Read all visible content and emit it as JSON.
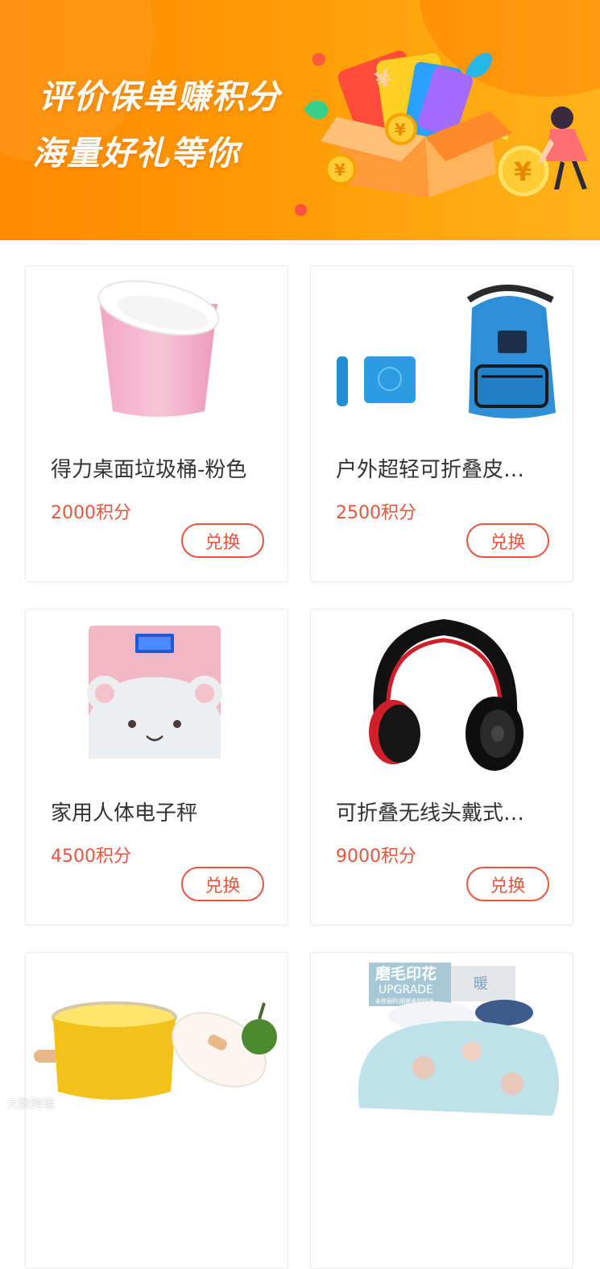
{
  "banner": {
    "title": "评价保单赚积分",
    "subtitle": "海量好礼等你",
    "currency_symbol": "¥"
  },
  "products": [
    {
      "name": "得力桌面垃圾桶-粉色",
      "points": "2000积分",
      "button": "兑换",
      "image_icon": "pink-trash-bin-image"
    },
    {
      "name": "户外超轻可折叠皮肤包",
      "display_name": "户外超轻可折叠皮…",
      "points": "2500积分",
      "button": "兑换",
      "image_icon": "blue-backpack-image"
    },
    {
      "name": "家用人体电子秤",
      "points": "4500积分",
      "button": "兑换",
      "image_icon": "bathroom-scale-image"
    },
    {
      "name": "可折叠无线头戴式耳机",
      "display_name": "可折叠无线头戴式…",
      "points": "9000积分",
      "button": "兑换",
      "image_icon": "headphones-image"
    },
    {
      "name": "",
      "points": "",
      "button": "",
      "image_icon": "yellow-pot-image"
    },
    {
      "name": "",
      "points": "",
      "button": "",
      "image_icon": "quilt-image",
      "image_text": {
        "headline": "磨毛印花",
        "upgrade": "UPGRADE",
        "small": "亲肤面料|细腻柔软舒适",
        "side": "暖"
      }
    }
  ],
  "watermark": "大数跨境",
  "colors": {
    "accent": "#e8553e",
    "banner_start": "#ff8a00",
    "banner_end": "#ffb31a",
    "text": "#333333"
  }
}
